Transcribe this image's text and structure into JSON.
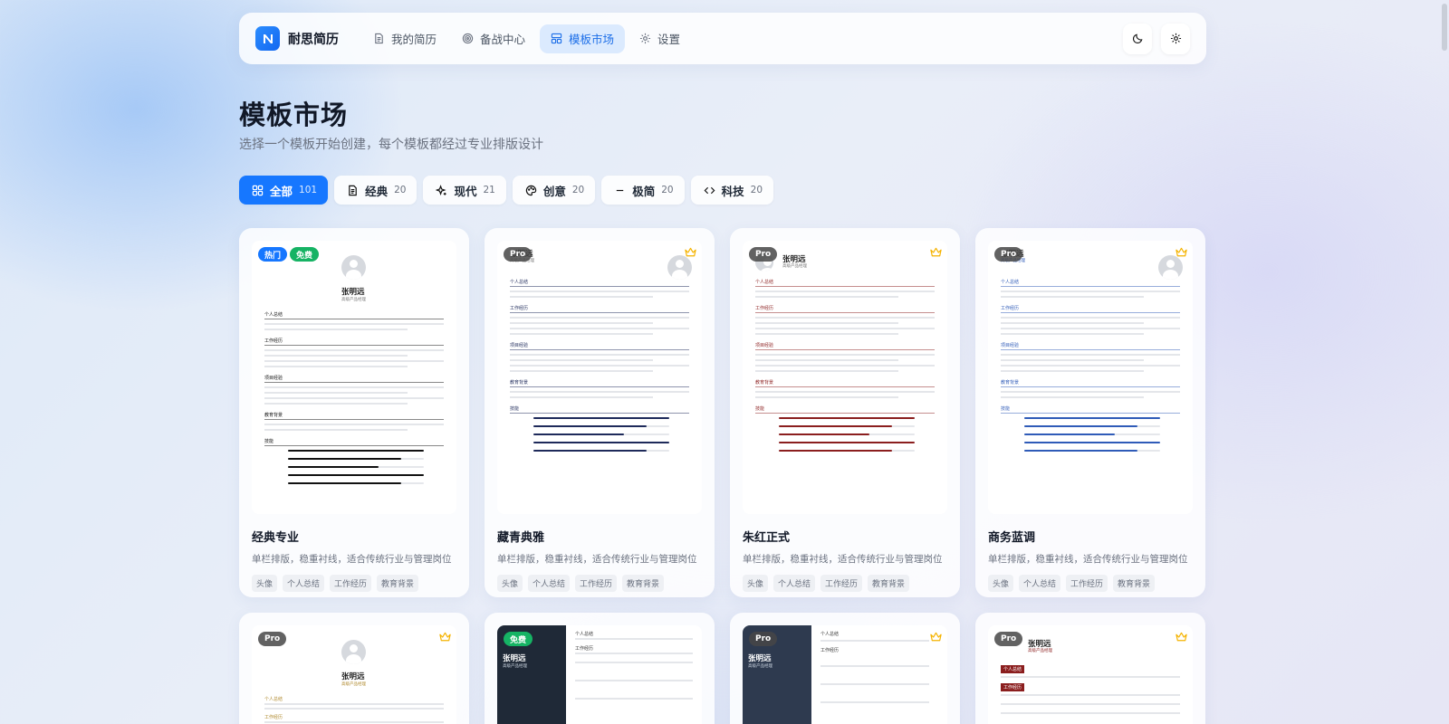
{
  "app": {
    "brand": "耐思简历"
  },
  "nav": {
    "items": [
      {
        "label": "我的简历",
        "icon": "document-icon"
      },
      {
        "label": "备战中心",
        "icon": "target-icon"
      },
      {
        "label": "模板市场",
        "icon": "layout-icon",
        "active": true
      },
      {
        "label": "设置",
        "icon": "gear-icon"
      }
    ],
    "right": [
      {
        "icon": "moon-icon"
      },
      {
        "icon": "settings-icon"
      }
    ]
  },
  "header": {
    "title": "模板市场",
    "subtitle": "选择一个模板开始创建，每个模板都经过专业排版设计"
  },
  "filters": [
    {
      "label": "全部",
      "count": "101",
      "icon": "grid-icon",
      "active": true
    },
    {
      "label": "经典",
      "count": "20",
      "icon": "document-icon"
    },
    {
      "label": "现代",
      "count": "21",
      "icon": "sparkle-icon"
    },
    {
      "label": "创意",
      "count": "20",
      "icon": "palette-icon"
    },
    {
      "label": "极简",
      "count": "20",
      "icon": "minus-icon"
    },
    {
      "label": "科技",
      "count": "20",
      "icon": "code-icon"
    }
  ],
  "templates": [
    {
      "title": "经典专业",
      "desc": "单栏排版，稳重衬线，适合传统行业与管理岗位",
      "badges": [
        "热门",
        "免费"
      ],
      "tags": [
        "头像",
        "个人总结",
        "工作经历",
        "教育背景"
      ],
      "accent": "#111111"
    },
    {
      "title": "藏青典雅",
      "desc": "单栏排版，稳重衬线，适合传统行业与管理岗位",
      "badges": [
        "Pro"
      ],
      "tags": [
        "头像",
        "个人总结",
        "工作经历",
        "教育背景"
      ],
      "accent": "#1e2a5a"
    },
    {
      "title": "朱红正式",
      "desc": "单栏排版，稳重衬线，适合传统行业与管理岗位",
      "badges": [
        "Pro"
      ],
      "tags": [
        "头像",
        "个人总结",
        "工作经历",
        "教育背景"
      ],
      "accent": "#8b1e1e"
    },
    {
      "title": "商务蓝调",
      "desc": "单栏排版，稳重衬线，适合传统行业与管理岗位",
      "badges": [
        "Pro"
      ],
      "tags": [
        "头像",
        "个人总结",
        "工作经历",
        "教育背景"
      ],
      "accent": "#2f5bb8"
    },
    {
      "title": "",
      "badges": [
        "Pro"
      ],
      "accent": "#b08a2e"
    },
    {
      "title": "",
      "badges": [
        "免费"
      ],
      "accent": "#1f2937"
    },
    {
      "title": "",
      "badges": [
        "Pro"
      ],
      "accent": "#2e3a4f"
    },
    {
      "title": "",
      "badges": [
        "Pro"
      ],
      "accent": "#8b1e1e"
    }
  ],
  "mock": {
    "name": "张明远",
    "role": "高级产品经理",
    "sections": [
      "个人总结",
      "工作经历",
      "项目经验",
      "教育背景",
      "技能"
    ],
    "section_personal": "个人总结",
    "section_work": "工作经历"
  },
  "colors": {
    "primary": "#1677ff",
    "free": "#16b364",
    "crown": "#f5b301"
  }
}
